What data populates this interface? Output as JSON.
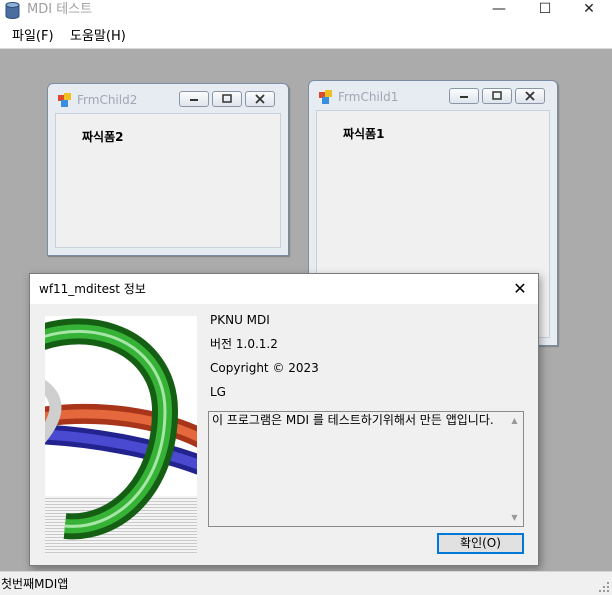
{
  "app": {
    "title": "MDI 테스트",
    "window_buttons": {
      "minimize": "—",
      "maximize": "☐",
      "close": "✕"
    }
  },
  "menu": {
    "items": [
      {
        "label": "파일(F)"
      },
      {
        "label": "도움말(H)"
      }
    ]
  },
  "children": [
    {
      "title": "FrmChild2",
      "label": "짜식폼2"
    },
    {
      "title": "FrmChild1",
      "label": "짜식폼1"
    }
  ],
  "about_dialog": {
    "title": "wf11_mditest 정보",
    "close": "✕",
    "product": "PKNU MDI",
    "version": "버전 1.0.1.2",
    "copyright": "Copyright ©  2023",
    "company": "LG",
    "description": "이 프로그램은 MDI 를 테스트하기위해서 만든 앱입니다.",
    "ok_label": "확인(O)",
    "scroll_up": "▲",
    "scroll_down": "▼"
  },
  "status": {
    "text": "첫번째MDI앱"
  },
  "colors": {
    "mdi_background": "#ababab",
    "accent": "#0078d7"
  }
}
